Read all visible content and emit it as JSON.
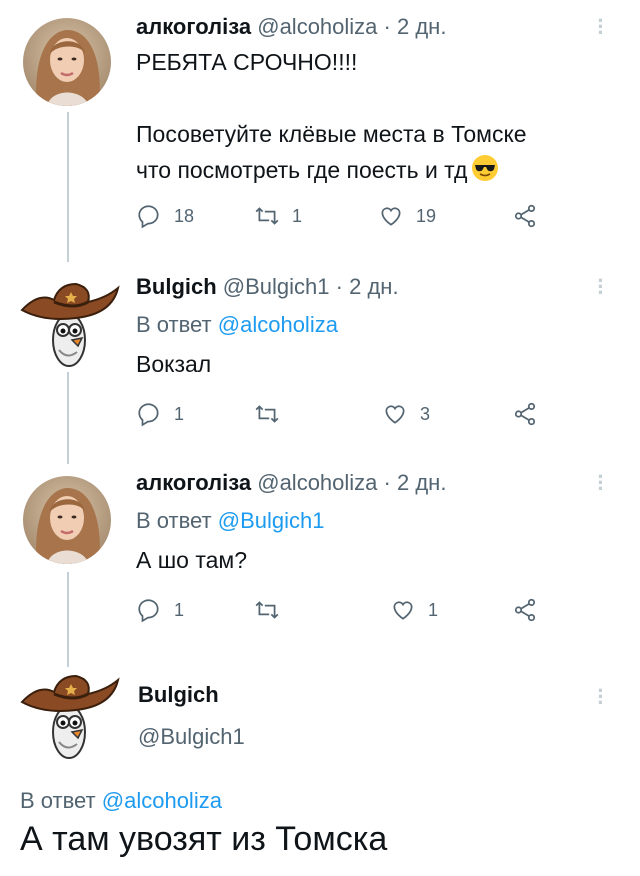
{
  "tweets": [
    {
      "name": "алкоголіза",
      "handle": "@alcoholiza",
      "sep": "·",
      "time": "2 дн.",
      "text_lines": [
        "РЕБЯТА СРОЧНО!!!!",
        "",
        "Посоветуйте клёвые места в Томске",
        "что посмотреть где поесть и тд"
      ],
      "emoji": "sunglasses-emoji",
      "replies": "18",
      "retweets": "1",
      "likes": "19"
    },
    {
      "name": "Bulgich",
      "handle": "@Bulgich1",
      "sep": "·",
      "time": "2 дн.",
      "reply_prefix": "В ответ",
      "reply_handle": "@alcoholiza",
      "text": "Вокзал",
      "replies": "1",
      "retweets": "",
      "likes": "3"
    },
    {
      "name": "алкоголіза",
      "handle": "@alcoholiza",
      "sep": "·",
      "time": "2 дн.",
      "reply_prefix": "В ответ",
      "reply_handle": "@Bulgich1",
      "text": "А шо там?",
      "replies": "1",
      "retweets": "",
      "likes": "1"
    }
  ],
  "main_tweet": {
    "name": "Bulgich",
    "handle": "@Bulgich1",
    "reply_prefix": "В ответ",
    "reply_handle": "@alcoholiza",
    "text": "А там увозят из Томска"
  },
  "colors": {
    "link": "#1d9bf0",
    "muted": "#536471",
    "thread_line": "#c4cfd6"
  }
}
